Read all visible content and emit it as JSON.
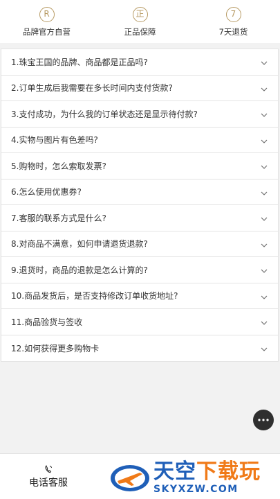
{
  "badges": [
    {
      "glyph": "R",
      "label": "品牌官方自营"
    },
    {
      "glyph": "正",
      "label": "正品保障"
    },
    {
      "glyph": "7",
      "label": "7天退货"
    }
  ],
  "faq": [
    "1.珠宝王国的品牌、商品都是正品吗?",
    "2.订单生成后我需要在多长时间内支付货款?",
    "3.支付成功，为什么我的订单状态还是显示待付款?",
    "4.实物与图片有色差吗?",
    "5.购物时，怎么索取发票?",
    "6.怎么使用优惠券?",
    "7.客服的联系方式是什么?",
    "8.对商品不满意，如何申请退货退款?",
    "9.退货时，商品的退款是怎么计算的?",
    "10.商品发货后，是否支持修改订单收货地址?",
    "11.商品验货与签收",
    "12.如何获得更多购物卡"
  ],
  "bottom": {
    "phone_label": "电话客服"
  },
  "watermark": {
    "cn_part1": "天空",
    "cn_part2": "下载玩",
    "url": "SKYXZW.COM"
  },
  "icons": {
    "accent": "#b79a63",
    "chevron": "chevron-down-icon",
    "more": "more-dots-icon",
    "phone": "phone-icon"
  }
}
